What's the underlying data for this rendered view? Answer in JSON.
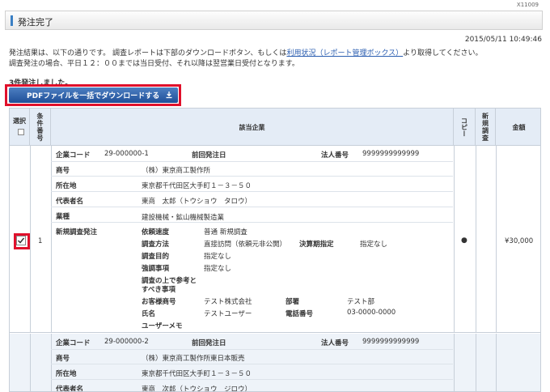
{
  "screen_id": "X11009",
  "page_title": "発注完了",
  "timestamp": "2015/05/11 10:49:46",
  "message_line1_prefix": "発注結果は、以下の通りです。 調査レポートは下部のダウンロードボタン、もしくは",
  "message_link": "利用状況（レポート管理ボックス）",
  "message_line1_suffix": "より取得してください。",
  "message_line2": "調査発注の場合、平日１２：００までは当日受付、それ以降は翌営業日受付となります。",
  "order_count": "3件発注しました。",
  "download_button": "PDFファイルを一括でダウンロードする",
  "table": {
    "headers": {
      "select": "選択",
      "condition_no": "条件番号",
      "company": "該当企業",
      "copy": "コピー",
      "new_survey": "新規調査",
      "amount": "金額"
    },
    "rows": [
      {
        "no": "1",
        "checked": true,
        "company_code_label": "企業コード",
        "company_code": "29-000000-1",
        "prev_order_label": "前回発注日",
        "prev_order": "",
        "corp_no_label": "法人番号",
        "corp_no": "9999999999999",
        "trade_name_label": "商号",
        "trade_name": "（株）東京商工製作所",
        "address_label": "所在地",
        "address": "東京都千代田区大手町１－３－５０",
        "rep_label": "代表者名",
        "rep": "東商　太郎（トウショウ　タロウ）",
        "industry_label": "業種",
        "industry": "建設機械・鉱山機械製造業",
        "new_survey_label": "新規調査発注",
        "speed_label": "依頼速度",
        "speed": "普通 新規調査",
        "method_label": "調査方法",
        "method": "直接訪問（依頼元非公開）",
        "fiscal_label": "決算期指定",
        "fiscal": "指定なし",
        "purpose_label": "調査目的",
        "purpose": "指定なし",
        "focus_label": "強調事項",
        "focus": "指定なし",
        "notes_label_1": "調査の上で参考と",
        "notes_label_2": "すべき事項",
        "customer_label": "お客様商号",
        "customer": "テスト株式会社",
        "dept_label": "部署",
        "dept": "テスト部",
        "name_label": "氏名",
        "name": "テストユーザー",
        "phone_label": "電話番号",
        "phone": "03-0000-0000",
        "memo_label": "ユーザーメモ",
        "copy_mark": "●",
        "amount": "¥30,000"
      },
      {
        "no": "",
        "company_code_label": "企業コード",
        "company_code": "29-000000-2",
        "prev_order_label": "前回発注日",
        "corp_no_label": "法人番号",
        "corp_no": "9999999999999",
        "trade_name_label": "商号",
        "trade_name": "（株）東京商工製作所東日本販売",
        "address_label": "所在地",
        "address": "東京都千代田区大手町１－３－５０",
        "rep_label": "代表者名",
        "rep": "東商　次郎（トウショウ　ジロウ）"
      }
    ]
  },
  "colors": {
    "accent": "#3a7fc4",
    "highlight": "#e0102b",
    "button": "#2a5aa3",
    "link": "#2a5db0"
  }
}
